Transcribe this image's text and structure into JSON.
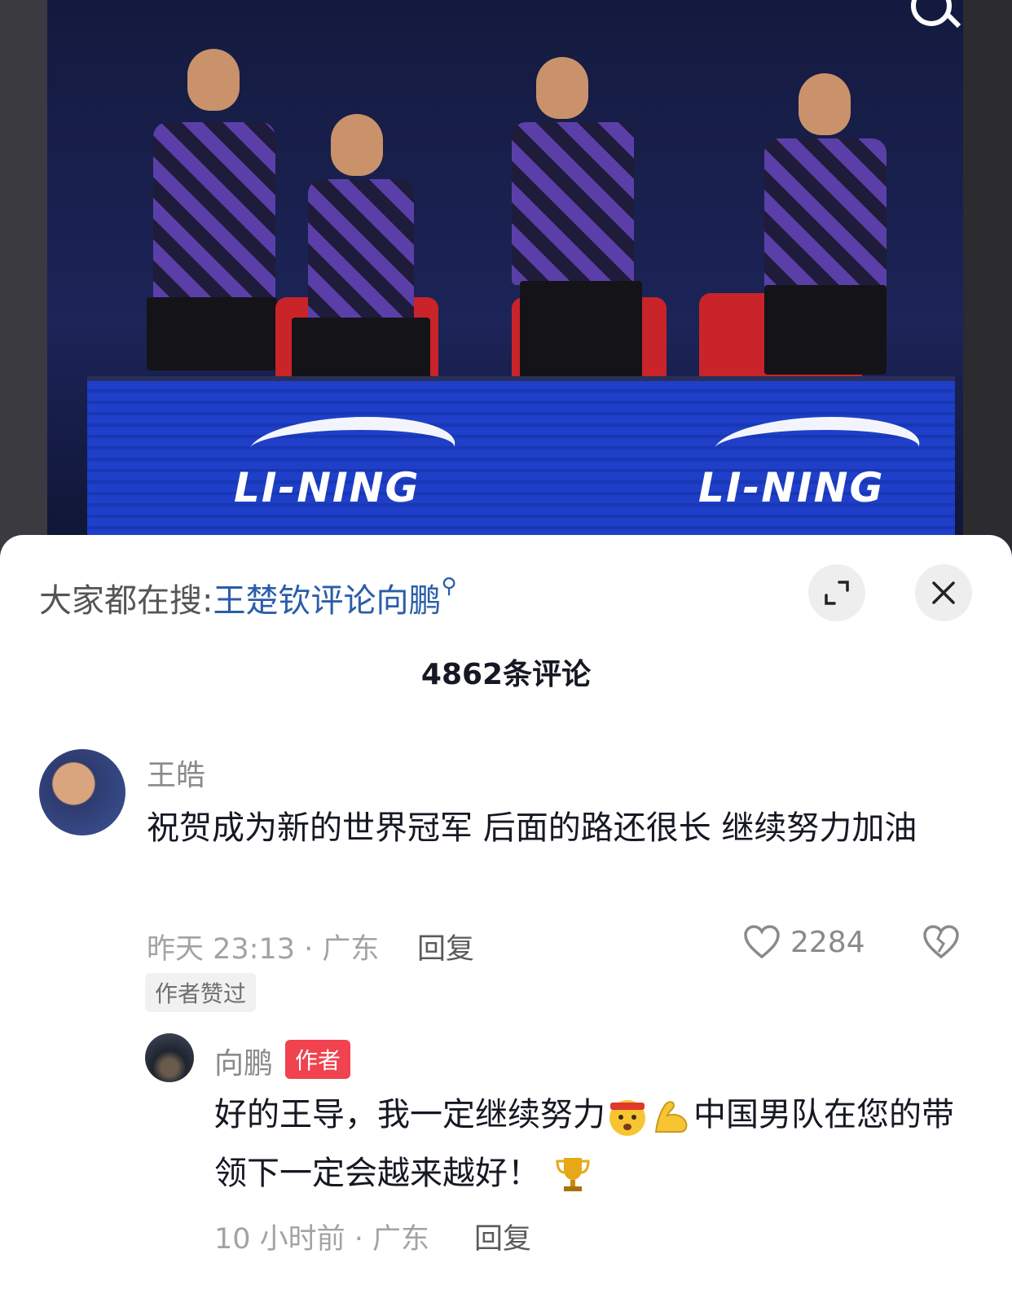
{
  "photo": {
    "brand_text": "LI-NING"
  },
  "hot_search": {
    "label": "大家都在搜:",
    "term": "王楚钦评论向鹏"
  },
  "comments_count": "4862条评论",
  "comment": {
    "author": "王皓",
    "text": "祝贺成为新的世界冠军 后面的路还很长 继续努力加油",
    "time_location": "昨天 23:13 · 广东",
    "reply_label": "回复",
    "likes": "2284",
    "liked_by_author_badge": "作者赞过"
  },
  "reply": {
    "author": "向鹏",
    "author_badge": "作者",
    "text_part1": "好的王导，我一定继续努力",
    "text_part2": "中国男队在您的带领下一定会越来越好！",
    "time_location": "10 小时前 · 广东",
    "reply_label": "回复"
  },
  "colors": {
    "link": "#2a5ea8",
    "author_badge": "#f0424f",
    "board_blue": "#1f3fc9"
  }
}
